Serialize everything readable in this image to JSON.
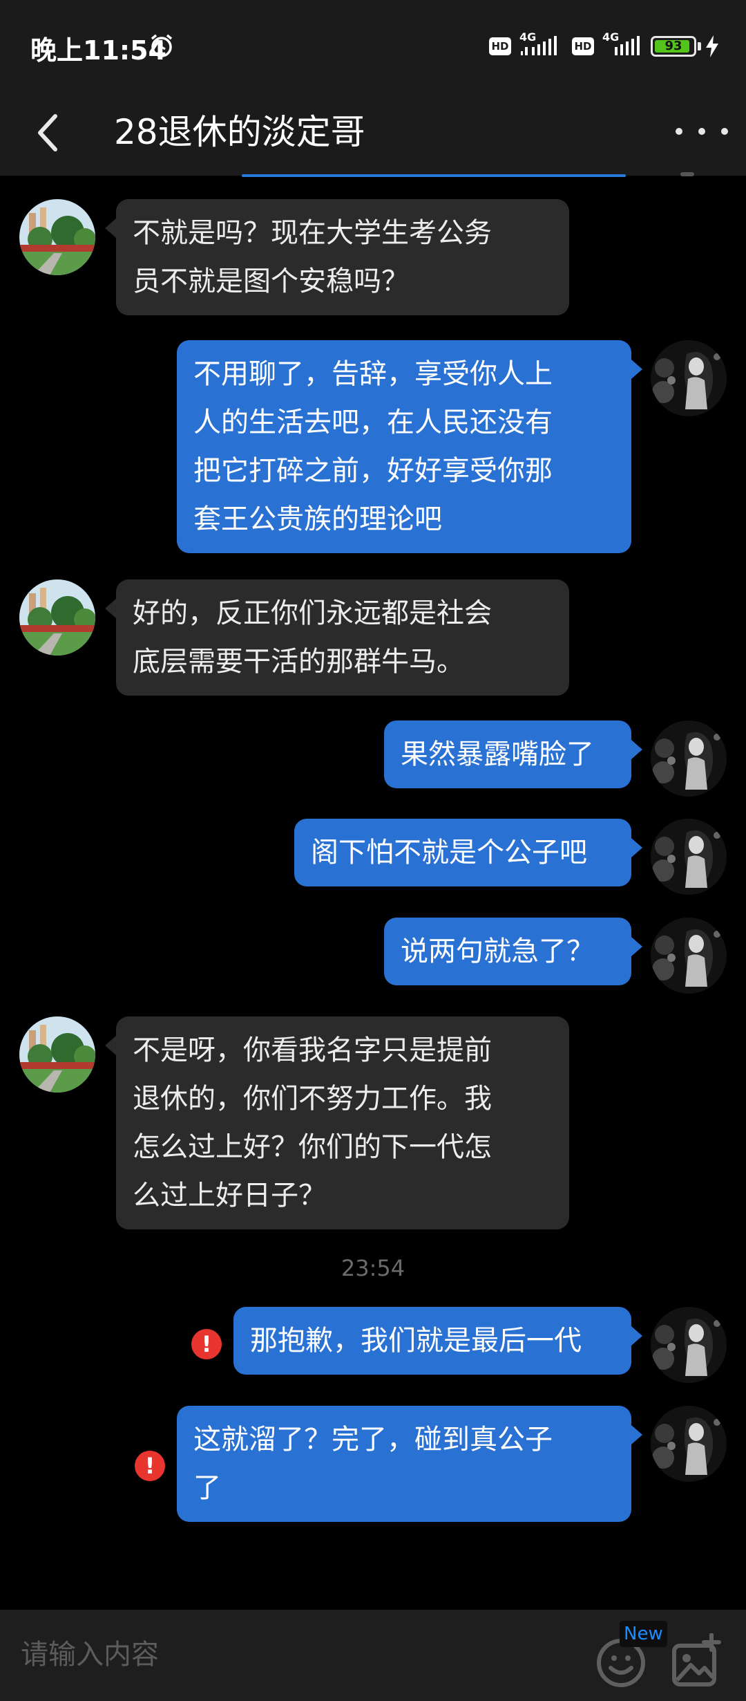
{
  "status_bar": {
    "time": "晚上11:54",
    "battery": "93",
    "network_label": "4G",
    "hd_label": "HD",
    "icons": [
      "alarm-icon",
      "hd-icon",
      "signal-icon",
      "battery-icon",
      "charging-icon"
    ]
  },
  "header": {
    "title": "28退休的淡定哥",
    "back_icon": "chevron-left-icon",
    "more_icon": "more-horizontal-icon"
  },
  "messages": [
    {
      "side": "in",
      "lines": [
        "不就是吗？现在大学生考公务",
        "员不就是图个安稳吗？"
      ]
    },
    {
      "side": "out",
      "lines": [
        "不用聊了，告辞，享受你人上",
        "人的生活去吧，在人民还没有",
        "把它打碎之前，好好享受你那",
        "套王公贵族的理论吧"
      ]
    },
    {
      "side": "in",
      "lines": [
        "好的，反正你们永远都是社会",
        "底层需要干活的那群牛马。"
      ]
    },
    {
      "side": "out",
      "lines": [
        "果然暴露嘴脸了"
      ]
    },
    {
      "side": "out",
      "lines": [
        "阁下怕不就是个公子吧"
      ]
    },
    {
      "side": "out",
      "lines": [
        "说两句就急了？"
      ]
    },
    {
      "side": "in",
      "lines": [
        "不是呀，你看我名字只是提前",
        "退休的，你们不努力工作。我",
        "怎么过上好？你们的下一代怎",
        "么过上好日子？"
      ]
    },
    {
      "side": "out",
      "lines": [
        "那抱歉，我们就是最后一代"
      ],
      "failed": true
    },
    {
      "side": "out",
      "lines": [
        "这就溜了？完了，碰到真公子",
        "了"
      ],
      "failed": true
    }
  ],
  "timestamp": "23:54",
  "error_mark": "!",
  "input": {
    "placeholder": "请输入内容",
    "new_badge": "New",
    "emoji_icon": "emoji-icon",
    "image_icon": "image-add-icon"
  },
  "colors": {
    "background": "#000000",
    "incoming_bubble": "#2b2b2b",
    "outgoing_bubble": "#2a71d4",
    "error": "#e8352f",
    "battery": "#52c41a"
  }
}
